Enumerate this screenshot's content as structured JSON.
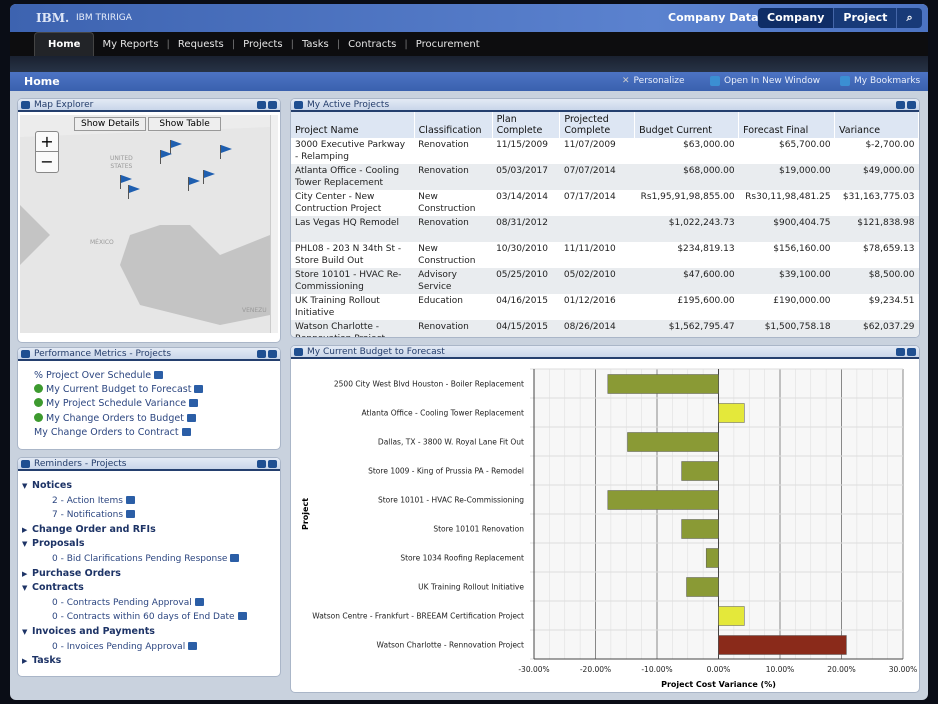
{
  "header": {
    "logo": "IBM.",
    "product": "IBM TRIRIGA",
    "company_data_label": "Company Data",
    "segments": [
      "Company",
      "Project"
    ],
    "search_icon": "search-icon"
  },
  "nav": {
    "tabs": [
      "Home",
      "My Reports",
      "Requests",
      "Projects",
      "Tasks",
      "Contracts",
      "Procurement"
    ],
    "active": "Home"
  },
  "titlebar": {
    "title": "Home",
    "personalize": "Personalize",
    "open_new_window": "Open In New Window",
    "bookmarks": "My Bookmarks"
  },
  "map": {
    "title": "Map Explorer",
    "show_details": "Show Details",
    "show_table": "Show Table",
    "zoom_in": "+",
    "zoom_out": "−",
    "labels": [
      "UNITED",
      "STATES",
      "MÉXICO",
      "VENEZU"
    ]
  },
  "projects": {
    "title": "My Active Projects",
    "columns": [
      "Project Name",
      "Classification",
      "Plan Complete",
      "Projected Complete",
      "Budget Current",
      "Forecast Final",
      "Variance"
    ],
    "rows": [
      [
        "3000 Executive Parkway - Relamping",
        "Renovation",
        "11/15/2009",
        "11/07/2009",
        "$63,000.00",
        "$65,700.00",
        "$-2,700.00"
      ],
      [
        "Atlanta Office - Cooling Tower Replacement",
        "Renovation",
        "05/03/2017",
        "07/07/2014",
        "$68,000.00",
        "$19,000.00",
        "$49,000.00"
      ],
      [
        "City Center - New Contruction Project",
        "New Construction",
        "03/14/2014",
        "07/17/2014",
        "Rs1,95,91,98,855.00",
        "Rs30,11,98,481.25",
        "$31,163,775.03"
      ],
      [
        "Las Vegas HQ Remodel",
        "Renovation",
        "08/31/2012",
        "",
        "$1,022,243.73",
        "$900,404.75",
        "$121,838.98"
      ],
      [
        "PHL08 - 203 N 34th St - Store Build Out",
        "New Construction",
        "10/30/2010",
        "11/11/2010",
        "$234,819.13",
        "$156,160.00",
        "$78,659.13"
      ],
      [
        "Store 10101 - HVAC Re-Commissioning",
        "Advisory Service",
        "05/25/2010",
        "05/02/2010",
        "$47,600.00",
        "$39,100.00",
        "$8,500.00"
      ],
      [
        "UK Training Rollout Initiative",
        "Education",
        "04/16/2015",
        "01/12/2016",
        "£195,600.00",
        "£190,000.00",
        "$9,234.51"
      ],
      [
        "Watson Charlotte - Rennovation Project",
        "Renovation",
        "04/15/2015",
        "08/26/2014",
        "$1,562,795.47",
        "$1,500,758.18",
        "$62,037.29"
      ]
    ]
  },
  "metrics": {
    "title": "Performance Metrics - Projects",
    "items": [
      {
        "label": "% Project Over Schedule",
        "check": false
      },
      {
        "label": "My Current Budget to Forecast",
        "check": true
      },
      {
        "label": "My Project Schedule Variance",
        "check": true
      },
      {
        "label": "My Change Orders to Budget",
        "check": true
      },
      {
        "label": "My Change Orders to Contract",
        "check": false
      }
    ]
  },
  "reminders": {
    "title": "Reminders - Projects",
    "groups": [
      {
        "label": "Notices",
        "expanded": true,
        "items": [
          "2 - Action Items",
          "7 - Notifications"
        ]
      },
      {
        "label": "Change Order and RFIs",
        "expanded": false,
        "items": []
      },
      {
        "label": "Proposals",
        "expanded": true,
        "items": [
          "0 - Bid Clarifications Pending Response"
        ]
      },
      {
        "label": "Purchase Orders",
        "expanded": false,
        "items": []
      },
      {
        "label": "Contracts",
        "expanded": true,
        "items": [
          "0 - Contracts Pending Approval",
          "0 - Contracts within 60 days of End Date"
        ]
      },
      {
        "label": "Invoices and Payments",
        "expanded": true,
        "items": [
          "0 - Invoices Pending Approval"
        ]
      },
      {
        "label": "Tasks",
        "expanded": false,
        "items": []
      }
    ]
  },
  "budget_panel": {
    "title": "My Current Budget to Forecast"
  },
  "chart_data": {
    "type": "bar",
    "orientation": "horizontal",
    "xlabel": "Project Cost Variance (%)",
    "ylabel": "Project",
    "xlim": [
      -30,
      30
    ],
    "ticks": [
      "-30.00%",
      "-20.00%",
      "-10.00%",
      "0.00%",
      "10.00%",
      "20.00%",
      "30.00%"
    ],
    "grid": true,
    "categories": [
      "2500 City West Blvd Houston - Boiler Replacement",
      "Atlanta Office - Cooling Tower Replacement",
      "Dallas, TX - 3800 W. Royal Lane Fit Out",
      "Store 1009 - King of Prussia PA -  Remodel",
      "Store 10101 - HVAC Re-Commissioning",
      "Store 10101 Renovation",
      "Store 1034 Roofing Replacement",
      "UK Training Rollout Initiative",
      "Watson Centre - Frankfurt - BREEAM Certification Project",
      "Watson Charlotte - Rennovation Project"
    ],
    "values": [
      -18,
      4.2,
      -14.8,
      -6,
      -18,
      -6,
      -2,
      -5.2,
      4.2,
      20.8
    ],
    "colors": {
      "negative": "#8a9a35",
      "small_positive": "#e4e83a",
      "large_positive": "#8a2a1a"
    }
  }
}
